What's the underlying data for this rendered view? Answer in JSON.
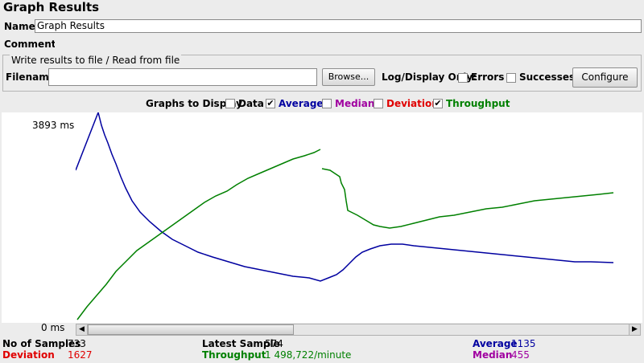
{
  "panel": {
    "title": "Graph Results",
    "name_label": "Name:",
    "name_value": "Graph Results",
    "comments_label": "Comments:"
  },
  "file_group": {
    "legend": "Write results to file / Read from file",
    "filename_label": "Filename",
    "filename_value": "",
    "browse_label": "Browse...",
    "log_display_label": "Log/Display Only:",
    "errors_label": "Errors",
    "successes_label": "Successes",
    "configure_label": "Configure"
  },
  "graphs": {
    "label": "Graphs to Display",
    "items": [
      {
        "label": "Data",
        "checked": false,
        "color": "#000000"
      },
      {
        "label": "Average",
        "checked": true,
        "color": "#0000a0"
      },
      {
        "label": "Median",
        "checked": false,
        "color": "#a000a0"
      },
      {
        "label": "Deviation",
        "checked": false,
        "color": "#e00000"
      },
      {
        "label": "Throughput",
        "checked": true,
        "color": "#008000"
      }
    ]
  },
  "axis": {
    "y_max_label": "3893  ms",
    "y_min_label": "0  ms"
  },
  "stats": {
    "no_of_samples_label": "No of Samples",
    "no_of_samples": "733",
    "latest_sample_label": "Latest Sample",
    "latest_sample": "574",
    "average_label": "Average",
    "average": "1135",
    "deviation_label": "Deviation",
    "deviation": "1627",
    "throughput_label": "Throughput",
    "throughput": "1 498,722/minute",
    "median_label": "Median",
    "median": "455"
  },
  "colors": {
    "average": "#0000a0",
    "throughput": "#008000",
    "deviation": "#e00000",
    "median": "#a000a0"
  }
}
